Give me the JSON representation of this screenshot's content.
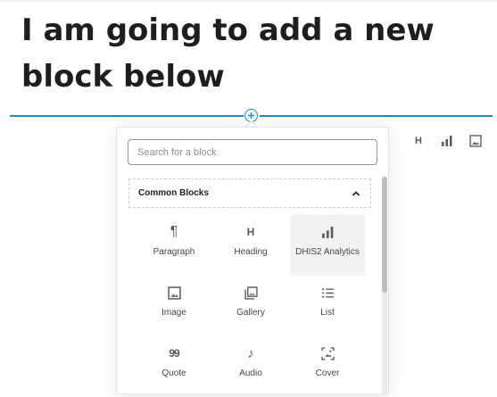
{
  "editor": {
    "heading": "I am going to add a new block below"
  },
  "toolbar": {
    "quick_icons": [
      {
        "icon": "heading-icon",
        "label": "H"
      },
      {
        "icon": "bar-chart-icon"
      },
      {
        "icon": "image-icon"
      }
    ]
  },
  "inserter": {
    "search_placeholder": "Search for a block",
    "panel_title": "Common Blocks",
    "panel_expanded": true,
    "items": [
      {
        "label": "Paragraph",
        "icon": "paragraph-icon",
        "glyph": "¶"
      },
      {
        "label": "Heading",
        "icon": "heading-icon",
        "glyph": "H"
      },
      {
        "label": "DHIS2 Analytics",
        "icon": "bar-chart-icon",
        "highlighted": true
      },
      {
        "label": "Image",
        "icon": "image-icon"
      },
      {
        "label": "Gallery",
        "icon": "gallery-icon"
      },
      {
        "label": "List",
        "icon": "list-icon"
      },
      {
        "label": "Quote",
        "icon": "quote-icon",
        "glyph": "99"
      },
      {
        "label": "Audio",
        "icon": "audio-icon",
        "glyph": "♪"
      },
      {
        "label": "Cover",
        "icon": "cover-icon"
      }
    ]
  },
  "colors": {
    "accent": "#1e8cbe",
    "icon": "#555d66",
    "text": "#1e1e1e"
  }
}
